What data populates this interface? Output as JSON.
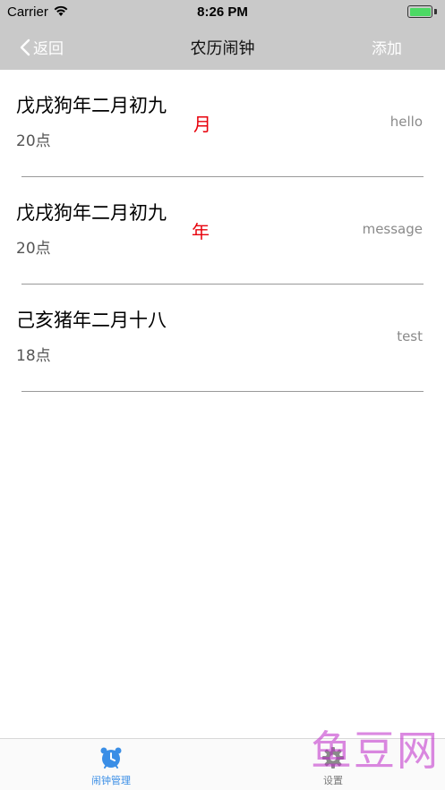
{
  "status_bar": {
    "carrier": "Carrier",
    "time": "8:26 PM"
  },
  "nav": {
    "back_label": "返回",
    "title": "农历闹钟",
    "add_label": "添加"
  },
  "alarms": [
    {
      "date": "戊戌狗年二月初九",
      "badge": "月",
      "hour": "20点",
      "note": "hello"
    },
    {
      "date": "戊戌狗年二月初九",
      "badge": "年",
      "hour": "20点",
      "note": "message"
    },
    {
      "date": "己亥猪年二月十八",
      "badge": "",
      "hour": "18点",
      "note": "test"
    }
  ],
  "tabbar": {
    "tabs": [
      {
        "label": "闹钟管理",
        "icon": "alarm-clock-icon",
        "active": true
      },
      {
        "label": "设置",
        "icon": "gear-icon",
        "active": false
      }
    ]
  },
  "watermark": {
    "text": "鱼豆网"
  },
  "colors": {
    "nav_bg": "#c9c9c9",
    "badge": "#e8000b",
    "tab_active": "#3a8ee6",
    "watermark": "#be28c8"
  }
}
